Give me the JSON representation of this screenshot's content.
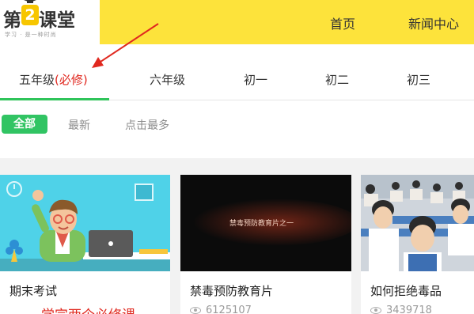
{
  "logo": {
    "text_before": "第",
    "badge": "2",
    "text_after": "课堂",
    "tagline": "学习 · 是一种时尚",
    "icon": "graduation-cap-icon"
  },
  "nav": {
    "home": "首页",
    "news": "新闻中心"
  },
  "grades": {
    "grade5": "五年级",
    "grade5_required": "(必修)",
    "grade6": "六年级",
    "junior1": "初一",
    "junior2": "初二",
    "junior3": "初三"
  },
  "filters": {
    "all": "全部",
    "latest": "最新",
    "most_clicked": "点击最多"
  },
  "cards": [
    {
      "title": "期末考试",
      "views": ""
    },
    {
      "title": "禁毒预防教育片",
      "views": "6125107",
      "thumb_text": "禁毒预防教育片之一"
    },
    {
      "title": "如何拒绝毒品",
      "views": "3439718"
    }
  ],
  "annotation": "学完两个必修课",
  "colors": {
    "header": "#fde33b",
    "accent_green": "#31c463",
    "required_red": "#e0281f"
  }
}
